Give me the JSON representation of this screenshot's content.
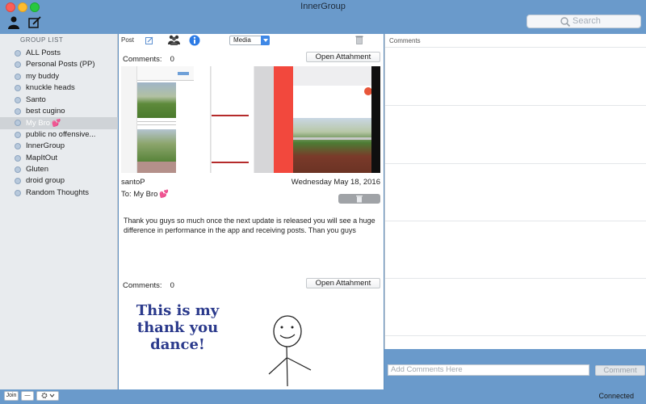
{
  "window": {
    "title": "InnerGroup"
  },
  "toolbar": {
    "search_placeholder": "Search",
    "profile_icon": "person-icon",
    "compose_icon": "compose-icon"
  },
  "sidebar": {
    "header": "GROUP LIST",
    "items": [
      {
        "label": "ALL Posts"
      },
      {
        "label": "Personal Posts (PP)"
      },
      {
        "label": "my buddy"
      },
      {
        "label": "knuckle heads"
      },
      {
        "label": "Santo"
      },
      {
        "label": "best cugino"
      },
      {
        "label": "My Bro",
        "selected": true,
        "emoji": "💕"
      },
      {
        "label": "public no offensive..."
      },
      {
        "label": "InnerGroup"
      },
      {
        "label": "MapItOut"
      },
      {
        "label": "Gluten"
      },
      {
        "label": "droid group"
      },
      {
        "label": "Random Thoughts"
      }
    ]
  },
  "postbar": {
    "post_label": "Post",
    "media_select": "Media"
  },
  "posts": [
    {
      "comments_label": "Comments:",
      "comments_count": "0",
      "attachment_button": "Open Attahment",
      "author": "santoP",
      "date": "Wednesday May 18, 2016",
      "to": "To: My Bro",
      "to_emoji": "💕",
      "body": "Thank you guys so much once the next update is released you will see a huge difference in performance in the app and receiving posts.  Than you guys"
    },
    {
      "comments_label": "Comments:",
      "comments_count": "0",
      "attachment_button": "Open Attahment",
      "image_text": "This is my thank you dance!"
    }
  ],
  "comments_pane": {
    "header": "Comments",
    "input_placeholder": "Add Comments Here",
    "button": "Comment"
  },
  "bottombar": {
    "join_button": "Join",
    "minus_button": "—",
    "gear_icon": "gear-icon",
    "status": "Connected"
  }
}
